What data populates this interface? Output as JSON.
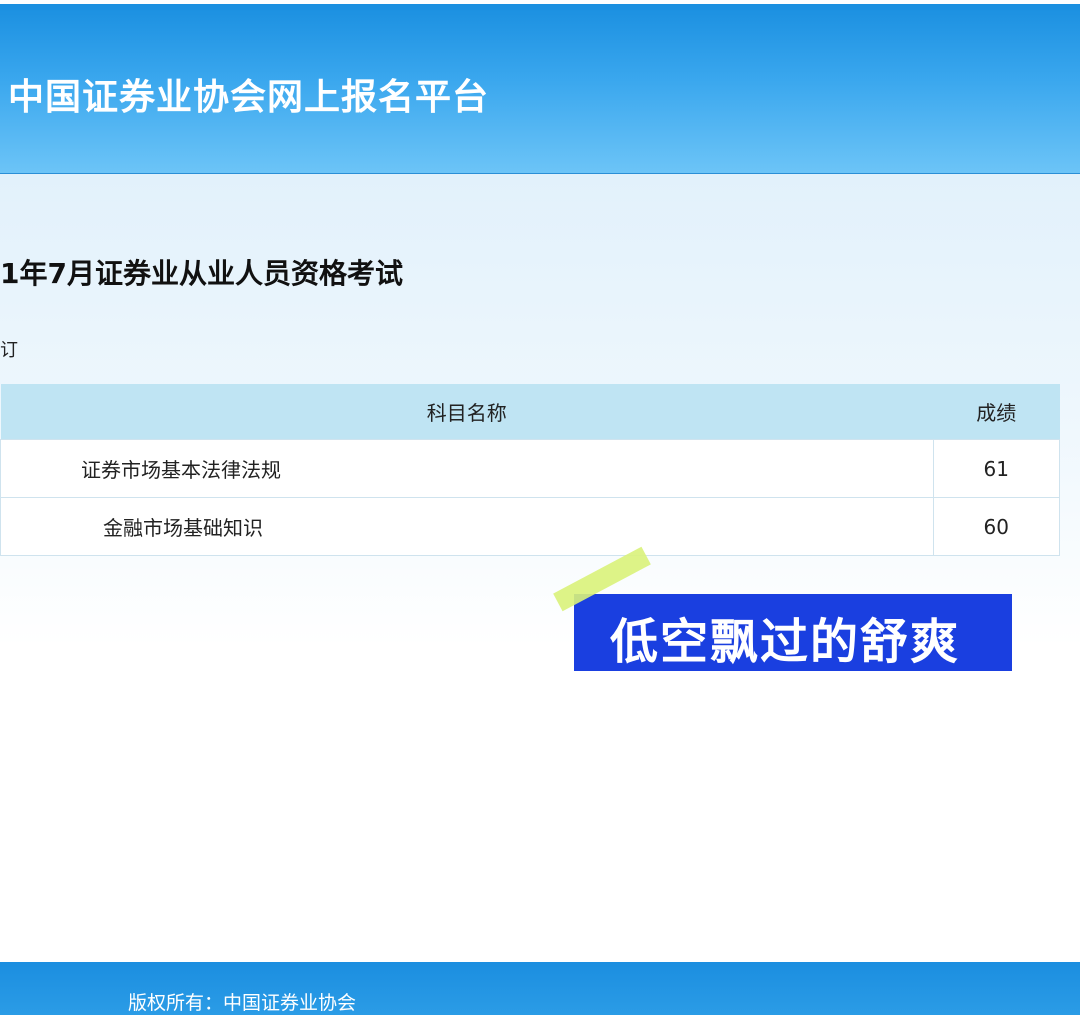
{
  "header": {
    "title": "中国证券业协会网上报名平台"
  },
  "main": {
    "exam_title": "1年7月证券业从业人员资格考试",
    "sub_label": "订",
    "table": {
      "columns": [
        "科目名称",
        "成绩"
      ],
      "rows": [
        {
          "subject": "证券市场基本法律法规",
          "score": "61"
        },
        {
          "subject": "金融市场基础知识",
          "score": "60"
        }
      ]
    }
  },
  "overlay": {
    "caption": "低空飘过的舒爽"
  },
  "footer": {
    "copyright": "版权所有：中国证券业协会"
  },
  "colors": {
    "header_blue": "#3aa7ee",
    "table_header": "#bfe4f3",
    "badge_blue": "#1a3fe0",
    "stripe_green": "#d9f27a"
  }
}
